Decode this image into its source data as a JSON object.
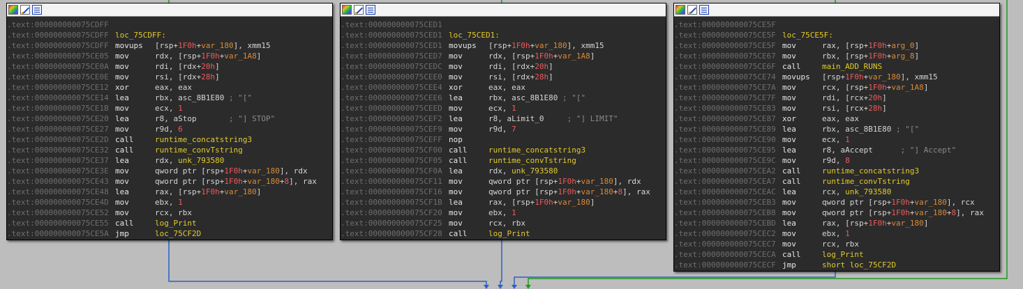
{
  "colors": {
    "background": "#bdbdbd",
    "node_body": "#2b2b2b",
    "address": "#6e6e6e",
    "label": "#e3cb2a",
    "number": "#ee5a5a",
    "variable": "#d98a3a",
    "edge_blue": "#2c5fc7",
    "edge_green": "#1e9a1e"
  },
  "header_icons": [
    "color-palette-icon",
    "edit-pencil-icon",
    "graph-view-icon"
  ],
  "nodes": [
    {
      "id": "node-75CDFF",
      "lines": [
        {
          "addr": ".text:000000000075CDFF"
        },
        {
          "addr": ".text:000000000075CDFF",
          "label": "loc_75CDFF:"
        },
        {
          "addr": ".text:000000000075CDFF",
          "mn": "movups",
          "ops": [
            [
              "[rsp+",
              "reg"
            ],
            [
              "1F0h",
              "num"
            ],
            [
              "+",
              "reg"
            ],
            [
              "var_180",
              "var"
            ],
            [
              "], xmm15",
              "reg"
            ]
          ]
        },
        {
          "addr": ".text:000000000075CE05",
          "mn": "mov",
          "ops": [
            [
              "rdx, [rsp+",
              "reg"
            ],
            [
              "1F0h",
              "num"
            ],
            [
              "+",
              "reg"
            ],
            [
              "var_1A8",
              "var"
            ],
            [
              "]",
              "reg"
            ]
          ]
        },
        {
          "addr": ".text:000000000075CE0A",
          "mn": "mov",
          "ops": [
            [
              "rdi, [rdx+",
              "reg"
            ],
            [
              "20h",
              "num"
            ],
            [
              "]",
              "reg"
            ]
          ]
        },
        {
          "addr": ".text:000000000075CE0E",
          "mn": "mov",
          "ops": [
            [
              "rsi, [rdx+",
              "reg"
            ],
            [
              "28h",
              "num"
            ],
            [
              "]",
              "reg"
            ]
          ]
        },
        {
          "addr": ".text:000000000075CE12",
          "mn": "xor",
          "ops": [
            [
              "eax, eax",
              "reg"
            ]
          ]
        },
        {
          "addr": ".text:000000000075CE14",
          "mn": "lea",
          "ops": [
            [
              "rbx, asc_8B1E80",
              "plain"
            ]
          ],
          "comment": "; \"[\""
        },
        {
          "addr": ".text:000000000075CE1B",
          "mn": "mov",
          "ops": [
            [
              "ecx, ",
              "reg"
            ],
            [
              "1",
              "num"
            ]
          ]
        },
        {
          "addr": ".text:000000000075CE20",
          "mn": "lea",
          "ops": [
            [
              "r8, aStop",
              "plain"
            ]
          ],
          "comment": "      ; \"] STOP\""
        },
        {
          "addr": ".text:000000000075CE27",
          "mn": "mov",
          "ops": [
            [
              "r9d, ",
              "reg"
            ],
            [
              "6",
              "num"
            ]
          ]
        },
        {
          "addr": ".text:000000000075CE2D",
          "mn": "call",
          "ops": [
            [
              "runtime_concatstring3",
              "sym"
            ]
          ]
        },
        {
          "addr": ".text:000000000075CE32",
          "mn": "call",
          "ops": [
            [
              "runtime_convTstring",
              "sym"
            ]
          ]
        },
        {
          "addr": ".text:000000000075CE37",
          "mn": "lea",
          "ops": [
            [
              "rdx, ",
              "reg"
            ],
            [
              "unk_793580",
              "sym"
            ]
          ]
        },
        {
          "addr": ".text:000000000075CE3E",
          "mn": "mov",
          "ops": [
            [
              "qword ptr [rsp+",
              "reg"
            ],
            [
              "1F0h",
              "num"
            ],
            [
              "+",
              "reg"
            ],
            [
              "var_180",
              "var"
            ],
            [
              "], rdx",
              "reg"
            ]
          ]
        },
        {
          "addr": ".text:000000000075CE43",
          "mn": "mov",
          "ops": [
            [
              "qword ptr [rsp+",
              "reg"
            ],
            [
              "1F0h",
              "num"
            ],
            [
              "+",
              "reg"
            ],
            [
              "var_180",
              "var"
            ],
            [
              "+",
              "reg"
            ],
            [
              "8",
              "num"
            ],
            [
              "], rax",
              "reg"
            ]
          ]
        },
        {
          "addr": ".text:000000000075CE48",
          "mn": "lea",
          "ops": [
            [
              "rax, [rsp+",
              "reg"
            ],
            [
              "1F0h",
              "num"
            ],
            [
              "+",
              "reg"
            ],
            [
              "var_180",
              "var"
            ],
            [
              "]",
              "reg"
            ]
          ]
        },
        {
          "addr": ".text:000000000075CE4D",
          "mn": "mov",
          "ops": [
            [
              "ebx, ",
              "reg"
            ],
            [
              "1",
              "num"
            ]
          ]
        },
        {
          "addr": ".text:000000000075CE52",
          "mn": "mov",
          "ops": [
            [
              "rcx, rbx",
              "reg"
            ]
          ]
        },
        {
          "addr": ".text:000000000075CE55",
          "mn": "call",
          "ops": [
            [
              "log_Print",
              "sym"
            ]
          ]
        },
        {
          "addr": ".text:000000000075CE5A",
          "mn": "jmp",
          "ops": [
            [
              "loc_75CF2D",
              "sym"
            ]
          ]
        }
      ]
    },
    {
      "id": "node-75CED1",
      "lines": [
        {
          "addr": ".text:000000000075CED1"
        },
        {
          "addr": ".text:000000000075CED1",
          "label": "loc_75CED1:"
        },
        {
          "addr": ".text:000000000075CED1",
          "mn": "movups",
          "ops": [
            [
              "[rsp+",
              "reg"
            ],
            [
              "1F0h",
              "num"
            ],
            [
              "+",
              "reg"
            ],
            [
              "var_180",
              "var"
            ],
            [
              "], xmm15",
              "reg"
            ]
          ]
        },
        {
          "addr": ".text:000000000075CED7",
          "mn": "mov",
          "ops": [
            [
              "rdx, [rsp+",
              "reg"
            ],
            [
              "1F0h",
              "num"
            ],
            [
              "+",
              "reg"
            ],
            [
              "var_1A8",
              "var"
            ],
            [
              "]",
              "reg"
            ]
          ]
        },
        {
          "addr": ".text:000000000075CEDC",
          "mn": "mov",
          "ops": [
            [
              "rdi, [rdx+",
              "reg"
            ],
            [
              "20h",
              "num"
            ],
            [
              "]",
              "reg"
            ]
          ]
        },
        {
          "addr": ".text:000000000075CEE0",
          "mn": "mov",
          "ops": [
            [
              "rsi, [rdx+",
              "reg"
            ],
            [
              "28h",
              "num"
            ],
            [
              "]",
              "reg"
            ]
          ]
        },
        {
          "addr": ".text:000000000075CEE4",
          "mn": "xor",
          "ops": [
            [
              "eax, eax",
              "reg"
            ]
          ]
        },
        {
          "addr": ".text:000000000075CEE6",
          "mn": "lea",
          "ops": [
            [
              "rbx, asc_8B1E80",
              "plain"
            ]
          ],
          "comment": "; \"[\""
        },
        {
          "addr": ".text:000000000075CEED",
          "mn": "mov",
          "ops": [
            [
              "ecx, ",
              "reg"
            ],
            [
              "1",
              "num"
            ]
          ]
        },
        {
          "addr": ".text:000000000075CEF2",
          "mn": "lea",
          "ops": [
            [
              "r8, aLimit_0",
              "plain"
            ]
          ],
          "comment": "    ; \"] LIMIT\""
        },
        {
          "addr": ".text:000000000075CEF9",
          "mn": "mov",
          "ops": [
            [
              "r9d, ",
              "reg"
            ],
            [
              "7",
              "num"
            ]
          ]
        },
        {
          "addr": ".text:000000000075CEFF",
          "mn": "nop"
        },
        {
          "addr": ".text:000000000075CF00",
          "mn": "call",
          "ops": [
            [
              "runtime_concatstring3",
              "sym"
            ]
          ]
        },
        {
          "addr": ".text:000000000075CF05",
          "mn": "call",
          "ops": [
            [
              "runtime_convTstring",
              "sym"
            ]
          ]
        },
        {
          "addr": ".text:000000000075CF0A",
          "mn": "lea",
          "ops": [
            [
              "rdx, ",
              "reg"
            ],
            [
              "unk_793580",
              "sym"
            ]
          ]
        },
        {
          "addr": ".text:000000000075CF11",
          "mn": "mov",
          "ops": [
            [
              "qword ptr [rsp+",
              "reg"
            ],
            [
              "1F0h",
              "num"
            ],
            [
              "+",
              "reg"
            ],
            [
              "var_180",
              "var"
            ],
            [
              "], rdx",
              "reg"
            ]
          ]
        },
        {
          "addr": ".text:000000000075CF16",
          "mn": "mov",
          "ops": [
            [
              "qword ptr [rsp+",
              "reg"
            ],
            [
              "1F0h",
              "num"
            ],
            [
              "+",
              "reg"
            ],
            [
              "var_180",
              "var"
            ],
            [
              "+",
              "reg"
            ],
            [
              "8",
              "num"
            ],
            [
              "], rax",
              "reg"
            ]
          ]
        },
        {
          "addr": ".text:000000000075CF1B",
          "mn": "lea",
          "ops": [
            [
              "rax, [rsp+",
              "reg"
            ],
            [
              "1F0h",
              "num"
            ],
            [
              "+",
              "reg"
            ],
            [
              "var_180",
              "var"
            ],
            [
              "]",
              "reg"
            ]
          ]
        },
        {
          "addr": ".text:000000000075CF20",
          "mn": "mov",
          "ops": [
            [
              "ebx, ",
              "reg"
            ],
            [
              "1",
              "num"
            ]
          ]
        },
        {
          "addr": ".text:000000000075CF25",
          "mn": "mov",
          "ops": [
            [
              "rcx, rbx",
              "reg"
            ]
          ]
        },
        {
          "addr": ".text:000000000075CF28",
          "mn": "call",
          "ops": [
            [
              "log_Print",
              "sym"
            ]
          ]
        }
      ]
    },
    {
      "id": "node-75CE5F",
      "lines": [
        {
          "addr": ".text:000000000075CE5F"
        },
        {
          "addr": ".text:000000000075CE5F",
          "label": "loc_75CE5F:"
        },
        {
          "addr": ".text:000000000075CE5F",
          "mn": "mov",
          "ops": [
            [
              "rax, [rsp+",
              "reg"
            ],
            [
              "1F0h",
              "num"
            ],
            [
              "+",
              "reg"
            ],
            [
              "arg_0",
              "var"
            ],
            [
              "]",
              "reg"
            ]
          ]
        },
        {
          "addr": ".text:000000000075CE67",
          "mn": "mov",
          "ops": [
            [
              "rbx, [rsp+",
              "reg"
            ],
            [
              "1F0h",
              "num"
            ],
            [
              "+",
              "reg"
            ],
            [
              "arg_8",
              "var"
            ],
            [
              "]",
              "reg"
            ]
          ]
        },
        {
          "addr": ".text:000000000075CE6F",
          "mn": "call",
          "ops": [
            [
              "main_ADD_RUNS",
              "sym"
            ]
          ]
        },
        {
          "addr": ".text:000000000075CE74",
          "mn": "movups",
          "ops": [
            [
              "[rsp+",
              "reg"
            ],
            [
              "1F0h",
              "num"
            ],
            [
              "+",
              "reg"
            ],
            [
              "var_180",
              "var"
            ],
            [
              "], xmm15",
              "reg"
            ]
          ]
        },
        {
          "addr": ".text:000000000075CE7A",
          "mn": "mov",
          "ops": [
            [
              "rcx, [rsp+",
              "reg"
            ],
            [
              "1F0h",
              "num"
            ],
            [
              "+",
              "reg"
            ],
            [
              "var_1A8",
              "var"
            ],
            [
              "]",
              "reg"
            ]
          ]
        },
        {
          "addr": ".text:000000000075CE7F",
          "mn": "mov",
          "ops": [
            [
              "rdi, [rcx+",
              "reg"
            ],
            [
              "20h",
              "num"
            ],
            [
              "]",
              "reg"
            ]
          ]
        },
        {
          "addr": ".text:000000000075CE83",
          "mn": "mov",
          "ops": [
            [
              "rsi, [rcx+",
              "reg"
            ],
            [
              "28h",
              "num"
            ],
            [
              "]",
              "reg"
            ]
          ]
        },
        {
          "addr": ".text:000000000075CE87",
          "mn": "xor",
          "ops": [
            [
              "eax, eax",
              "reg"
            ]
          ]
        },
        {
          "addr": ".text:000000000075CE89",
          "mn": "lea",
          "ops": [
            [
              "rbx, asc_8B1E80",
              "plain"
            ]
          ],
          "comment": "; \"[\""
        },
        {
          "addr": ".text:000000000075CE90",
          "mn": "mov",
          "ops": [
            [
              "ecx, ",
              "reg"
            ],
            [
              "1",
              "num"
            ]
          ]
        },
        {
          "addr": ".text:000000000075CE95",
          "mn": "lea",
          "ops": [
            [
              "r8, aAccept",
              "plain"
            ]
          ],
          "comment": "     ; \"] Accept\""
        },
        {
          "addr": ".text:000000000075CE9C",
          "mn": "mov",
          "ops": [
            [
              "r9d, ",
              "reg"
            ],
            [
              "8",
              "num"
            ]
          ]
        },
        {
          "addr": ".text:000000000075CEA2",
          "mn": "call",
          "ops": [
            [
              "runtime_concatstring3",
              "sym"
            ]
          ]
        },
        {
          "addr": ".text:000000000075CEA7",
          "mn": "call",
          "ops": [
            [
              "runtime_convTstring",
              "sym"
            ]
          ]
        },
        {
          "addr": ".text:000000000075CEAC",
          "mn": "lea",
          "ops": [
            [
              "rcx, ",
              "reg"
            ],
            [
              "unk_793580",
              "sym"
            ]
          ]
        },
        {
          "addr": ".text:000000000075CEB3",
          "mn": "mov",
          "ops": [
            [
              "qword ptr [rsp+",
              "reg"
            ],
            [
              "1F0h",
              "num"
            ],
            [
              "+",
              "reg"
            ],
            [
              "var_180",
              "var"
            ],
            [
              "], rcx",
              "reg"
            ]
          ]
        },
        {
          "addr": ".text:000000000075CEB8",
          "mn": "mov",
          "ops": [
            [
              "qword ptr [rsp+",
              "reg"
            ],
            [
              "1F0h",
              "num"
            ],
            [
              "+",
              "reg"
            ],
            [
              "var_180",
              "var"
            ],
            [
              "+",
              "reg"
            ],
            [
              "8",
              "num"
            ],
            [
              "], rax",
              "reg"
            ]
          ]
        },
        {
          "addr": ".text:000000000075CEBD",
          "mn": "lea",
          "ops": [
            [
              "rax, [rsp+",
              "reg"
            ],
            [
              "1F0h",
              "num"
            ],
            [
              "+",
              "reg"
            ],
            [
              "var_180",
              "var"
            ],
            [
              "]",
              "reg"
            ]
          ]
        },
        {
          "addr": ".text:000000000075CEC2",
          "mn": "mov",
          "ops": [
            [
              "ebx, ",
              "reg"
            ],
            [
              "1",
              "num"
            ]
          ]
        },
        {
          "addr": ".text:000000000075CEC7",
          "mn": "mov",
          "ops": [
            [
              "rcx, rbx",
              "reg"
            ]
          ]
        },
        {
          "addr": ".text:000000000075CECA",
          "mn": "call",
          "ops": [
            [
              "log_Print",
              "sym"
            ]
          ]
        },
        {
          "addr": ".text:000000000075CECF",
          "mn": "jmp",
          "ops": [
            [
              "short loc_75CF2D",
              "sym"
            ]
          ]
        }
      ]
    }
  ]
}
